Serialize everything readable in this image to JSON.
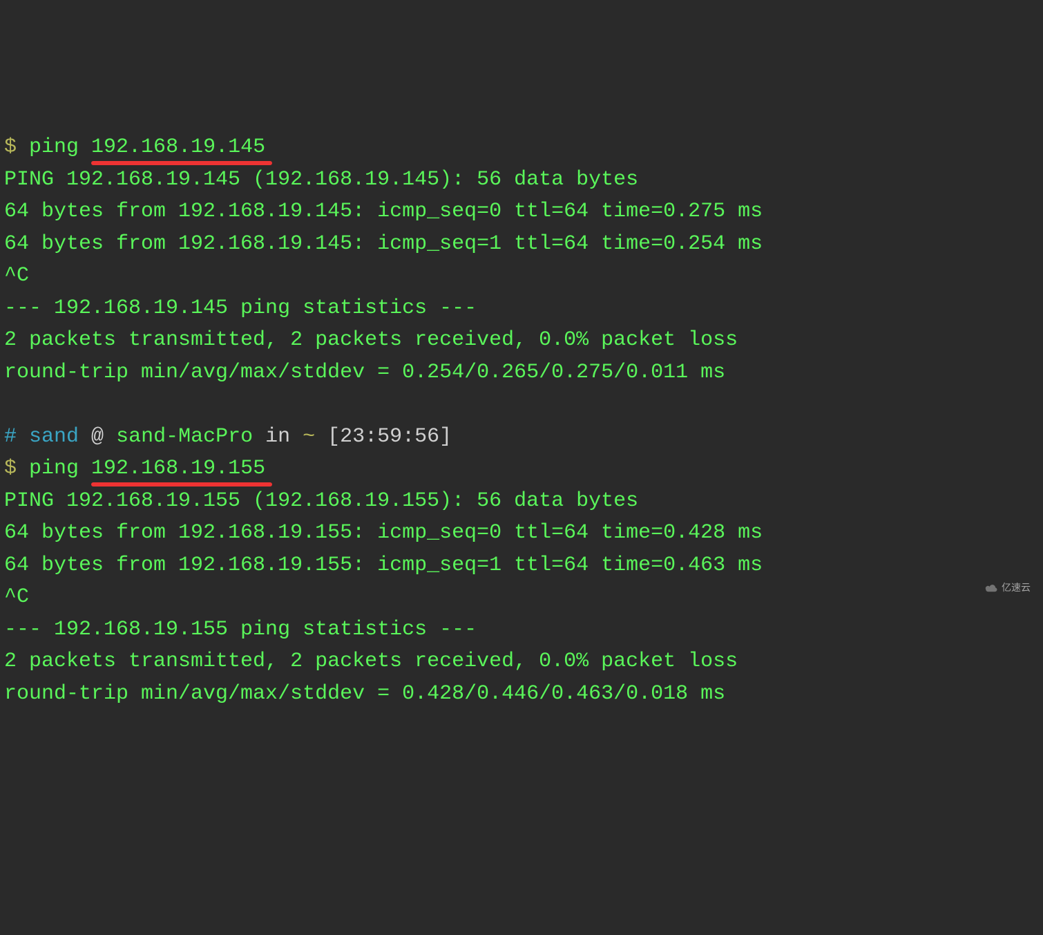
{
  "block1": {
    "prompt_symbol": "$",
    "cmd_prefix": "ping ",
    "ip": "192.168.19.145",
    "out1": "PING 192.168.19.145 (192.168.19.145): 56 data bytes",
    "out2": "64 bytes from 192.168.19.145: icmp_seq=0 ttl=64 time=0.275 ms",
    "out3": "64 bytes from 192.168.19.145: icmp_seq=1 ttl=64 time=0.254 ms",
    "out4": "^C",
    "out5": "--- 192.168.19.145 ping statistics ---",
    "out6": "2 packets transmitted, 2 packets received, 0.0% packet loss",
    "out7": "round-trip min/avg/max/stddev = 0.254/0.265/0.275/0.011 ms"
  },
  "prompt2": {
    "hash": "#",
    "user": "sand",
    "at": " @ ",
    "host": "sand-MacPro",
    "in": " in ",
    "path": "~",
    "time_bracket": " [23:59:56]"
  },
  "block2": {
    "prompt_symbol": "$",
    "cmd_prefix": "ping ",
    "ip": "192.168.19.155",
    "out1": "PING 192.168.19.155 (192.168.19.155): 56 data bytes",
    "out2": "64 bytes from 192.168.19.155: icmp_seq=0 ttl=64 time=0.428 ms",
    "out3": "64 bytes from 192.168.19.155: icmp_seq=1 ttl=64 time=0.463 ms",
    "out4": "^C",
    "out5": "--- 192.168.19.155 ping statistics ---",
    "out6": "2 packets transmitted, 2 packets received, 0.0% packet loss",
    "out7": "round-trip min/avg/max/stddev = 0.428/0.446/0.463/0.018 ms"
  },
  "watermark": "亿速云"
}
